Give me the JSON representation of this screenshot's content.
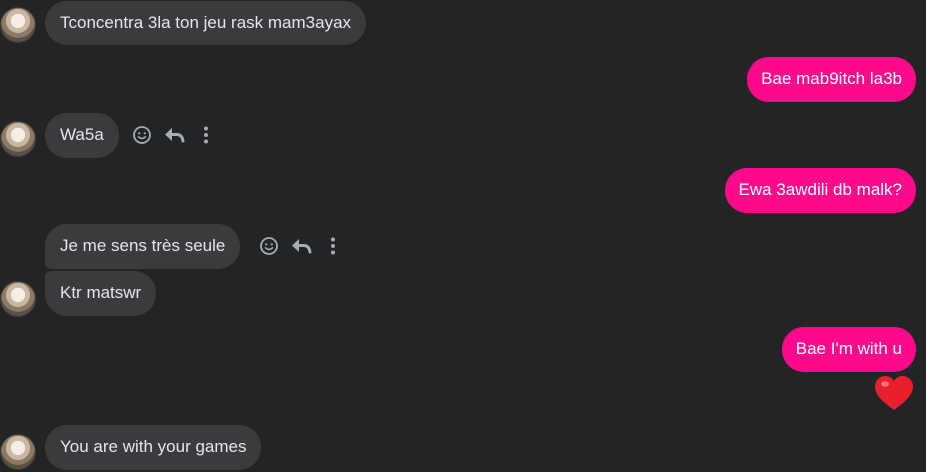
{
  "colors": {
    "background": "#232425",
    "incoming_bubble": "#3a3b3c",
    "outgoing_bubble": "#ff0a8c",
    "icon": "#a8abb0"
  },
  "messages": [
    {
      "id": "m1",
      "side": "incoming",
      "text": "Tconcentra 3la ton jeu rask mam3ayax"
    },
    {
      "id": "m2",
      "side": "outgoing",
      "text": "Bae mab9itch la3b"
    },
    {
      "id": "m3",
      "side": "incoming",
      "text": "Wa5a"
    },
    {
      "id": "m4",
      "side": "outgoing",
      "text": "Ewa 3awdili db malk?"
    },
    {
      "id": "m5",
      "side": "incoming",
      "text": "Je me sens très seule"
    },
    {
      "id": "m6",
      "side": "incoming",
      "text": "Ktr matswr"
    },
    {
      "id": "m7",
      "side": "outgoing",
      "text": "Bae I'm with u"
    },
    {
      "id": "m8",
      "side": "incoming",
      "text": "You are with your games"
    }
  ],
  "reaction": {
    "icon": "red-heart-icon"
  },
  "message_actions": [
    "smiley-react-icon",
    "reply-arrow-icon",
    "more-options-icon"
  ]
}
